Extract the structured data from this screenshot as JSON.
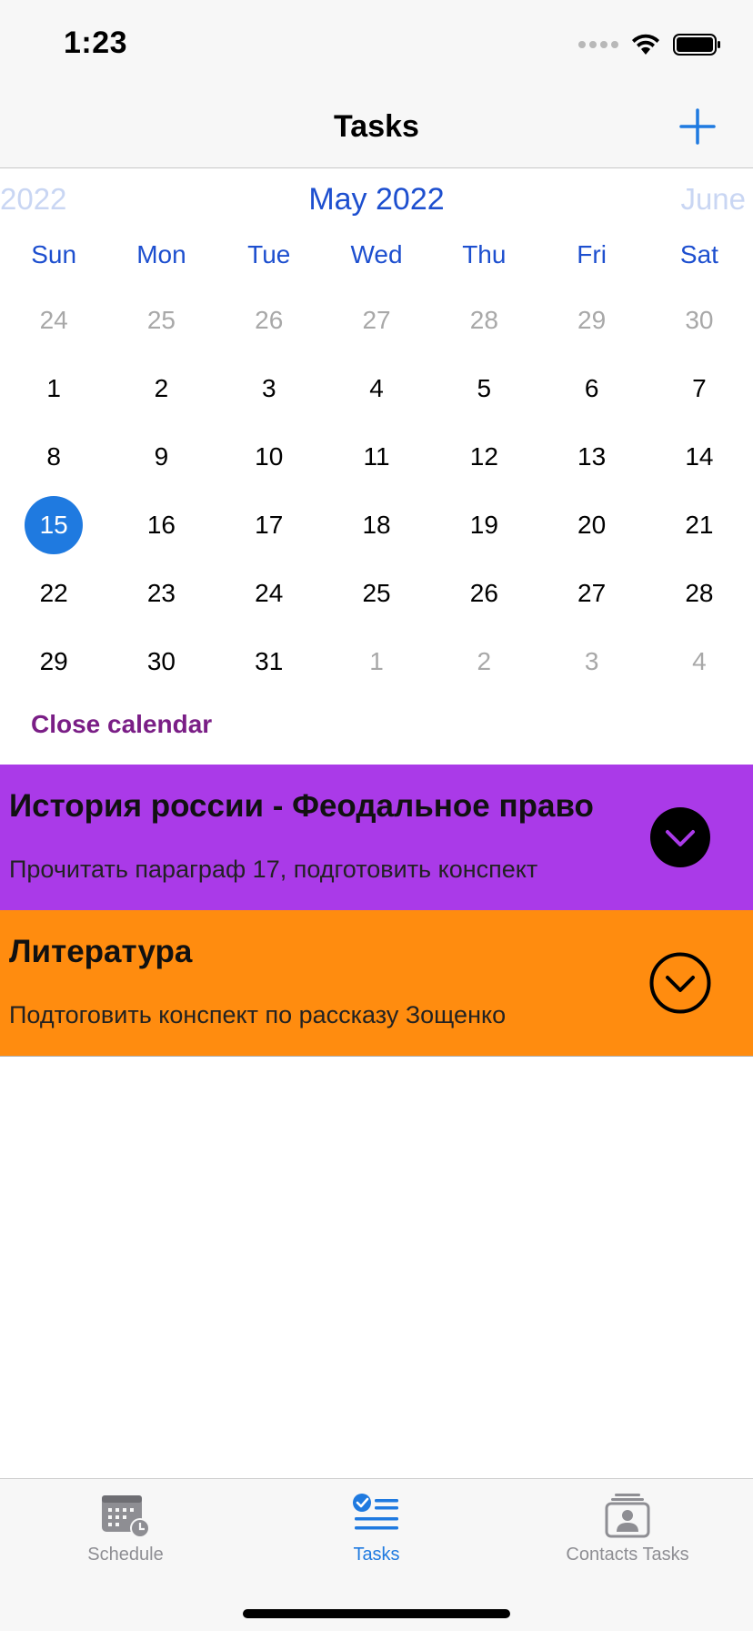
{
  "status_bar": {
    "time": "1:23"
  },
  "nav": {
    "title": "Tasks",
    "add_icon": "plus-icon"
  },
  "calendar": {
    "prev_label": "2022",
    "current_label": "May 2022",
    "next_label": "June",
    "weekdays": [
      "Sun",
      "Mon",
      "Tue",
      "Wed",
      "Thu",
      "Fri",
      "Sat"
    ],
    "days": [
      {
        "d": "24",
        "muted": true
      },
      {
        "d": "25",
        "muted": true
      },
      {
        "d": "26",
        "muted": true
      },
      {
        "d": "27",
        "muted": true
      },
      {
        "d": "28",
        "muted": true
      },
      {
        "d": "29",
        "muted": true
      },
      {
        "d": "30",
        "muted": true
      },
      {
        "d": "1"
      },
      {
        "d": "2"
      },
      {
        "d": "3"
      },
      {
        "d": "4"
      },
      {
        "d": "5"
      },
      {
        "d": "6"
      },
      {
        "d": "7"
      },
      {
        "d": "8"
      },
      {
        "d": "9"
      },
      {
        "d": "10"
      },
      {
        "d": "11"
      },
      {
        "d": "12"
      },
      {
        "d": "13"
      },
      {
        "d": "14"
      },
      {
        "d": "15",
        "selected": true
      },
      {
        "d": "16"
      },
      {
        "d": "17"
      },
      {
        "d": "18"
      },
      {
        "d": "19"
      },
      {
        "d": "20"
      },
      {
        "d": "21"
      },
      {
        "d": "22"
      },
      {
        "d": "23"
      },
      {
        "d": "24"
      },
      {
        "d": "25"
      },
      {
        "d": "26"
      },
      {
        "d": "27"
      },
      {
        "d": "28"
      },
      {
        "d": "29"
      },
      {
        "d": "30"
      },
      {
        "d": "31"
      },
      {
        "d": "1",
        "muted": true
      },
      {
        "d": "2",
        "muted": true
      },
      {
        "d": "3",
        "muted": true
      },
      {
        "d": "4",
        "muted": true
      }
    ],
    "selected_color": "#1f7ae0",
    "close_label": "Close calendar"
  },
  "tasks": [
    {
      "title": "История россии - Феодальное право",
      "description": "Прочитать параграф 17, подготовить конспект",
      "color": "#aa3ae8",
      "toggle_icon": "chevron-down-circle-filled-icon"
    },
    {
      "title": "Литература",
      "description": "Подтоговить конспект по рассказу Зощенко",
      "color": "#ff8c0f",
      "toggle_icon": "chevron-down-circle-outline-icon"
    }
  ],
  "tab_bar": {
    "tabs": [
      {
        "label": "Schedule",
        "icon": "calendar-clock-icon",
        "active": false
      },
      {
        "label": "Tasks",
        "icon": "checklist-icon",
        "active": true
      },
      {
        "label": "Contacts Tasks",
        "icon": "contact-card-icon",
        "active": false
      }
    ],
    "active_color": "#1f7ae0"
  }
}
